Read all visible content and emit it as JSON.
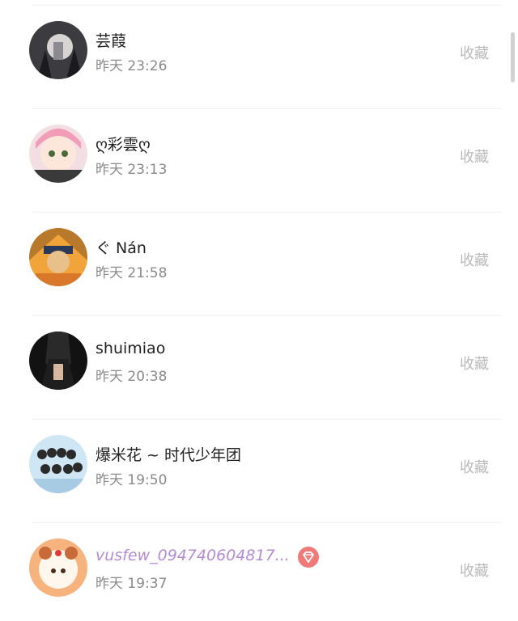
{
  "items": [
    {
      "name": "芸葭",
      "time": "昨天 23:26",
      "action": "收藏"
    },
    {
      "name": "ღ彩雲ღ",
      "time": "昨天 23:13",
      "action": "收藏"
    },
    {
      "name": "ぐ Nán",
      "time": "昨天 21:58",
      "action": "收藏"
    },
    {
      "name": "shuimiao",
      "time": "昨天 20:38",
      "action": "收藏"
    },
    {
      "name": "爆米花 ~ 时代少年团",
      "time": "昨天 19:50",
      "action": "收藏"
    },
    {
      "name": "vusfew_094740604817...",
      "time": "昨天 19:37",
      "action": "收藏"
    }
  ],
  "colors": {
    "name": "#222222",
    "time": "#8a8a8a",
    "action": "#b9b9b9",
    "vip_badge": "#f07a7a",
    "purple_name": "#b58ad6"
  },
  "icons": {
    "vip_badge": "diamond-icon"
  }
}
